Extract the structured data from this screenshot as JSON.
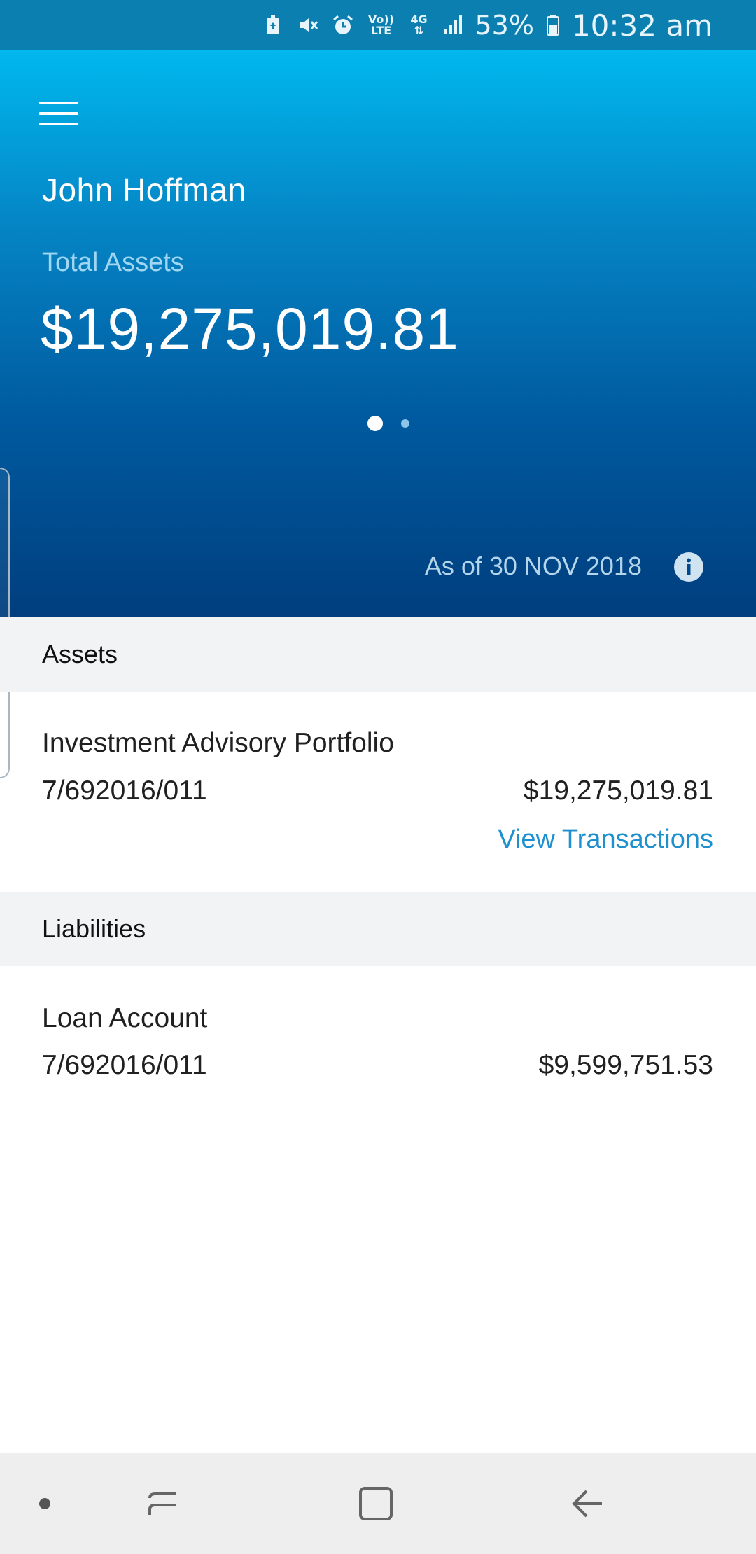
{
  "status_bar": {
    "net_top": "Vo))",
    "net_bottom": "LTE",
    "data_type": "4G",
    "battery_pct": "53%",
    "time": "10:32 am",
    "icons": [
      "battery-saver-icon",
      "mute-icon",
      "alarm-icon",
      "volte-icon",
      "data-arrows-icon",
      "signal-icon",
      "battery-icon"
    ]
  },
  "header": {
    "menu_icon": "hamburger-menu-icon",
    "user_name": "John Hoffman",
    "total_label": "Total Assets",
    "total_value": "$19,275,019.81",
    "pager": {
      "pages": 2,
      "active_page": 1
    },
    "as_of": "As of 30 NOV 2018",
    "info_icon": "info-icon"
  },
  "assets": {
    "heading": "Assets",
    "items": [
      {
        "name": "Investment Advisory Portfolio",
        "account_number": "7/692016/011",
        "amount": "$19,275,019.81",
        "link": "View Transactions"
      }
    ]
  },
  "liabilities": {
    "heading": "Liabilities",
    "items": [
      {
        "name": "Loan Account",
        "account_number": "7/692016/011",
        "amount": "$9,599,751.53"
      }
    ]
  },
  "colors": {
    "status_bar": "#0b7fb0",
    "hero_top": "#00b8ee",
    "hero_bottom": "#003e7e",
    "link": "#1e8fcf",
    "section_bg": "#f2f3f4"
  },
  "nav_bar": {
    "icons": [
      "nav-dot-icon",
      "recent-apps-icon",
      "home-icon",
      "back-icon"
    ]
  }
}
